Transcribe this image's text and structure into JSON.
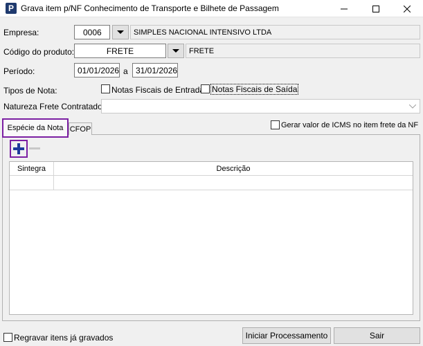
{
  "window": {
    "title": "Grava item p/NF Conhecimento de Transporte e Bilhete de Passagem",
    "app_icon_letter": "P"
  },
  "form": {
    "empresa_label": "Empresa:",
    "empresa_code": "0006",
    "empresa_name": "SIMPLES NACIONAL INTENSIVO LTDA",
    "produto_label": "Código do produto:",
    "produto_code": "FRETE",
    "produto_desc": "FRETE",
    "periodo_label": "Período:",
    "periodo_start": "01/01/2026",
    "periodo_sep": "a",
    "periodo_end": "31/01/2026",
    "tipos_label": "Tipos de Nota:",
    "nf_entrada_label": "Notas Fiscais de Entrada",
    "nf_saida_label": "Notas Fiscais de Saída",
    "natureza_label": "Natureza Frete Contratado:",
    "natureza_value": ""
  },
  "tabs": {
    "especie_label": "Espécie da Nota",
    "cfop_label": "CFOP",
    "icms_label": "Gerar valor de ICMS no item frete da NF"
  },
  "grid": {
    "columns": [
      "Sintegra",
      "Descrição"
    ],
    "rows": [
      [
        "",
        ""
      ]
    ]
  },
  "footer": {
    "regravar_label": "Regravar itens já gravados",
    "iniciar_label": "Iniciar Processamento",
    "sair_label": "Sair"
  }
}
